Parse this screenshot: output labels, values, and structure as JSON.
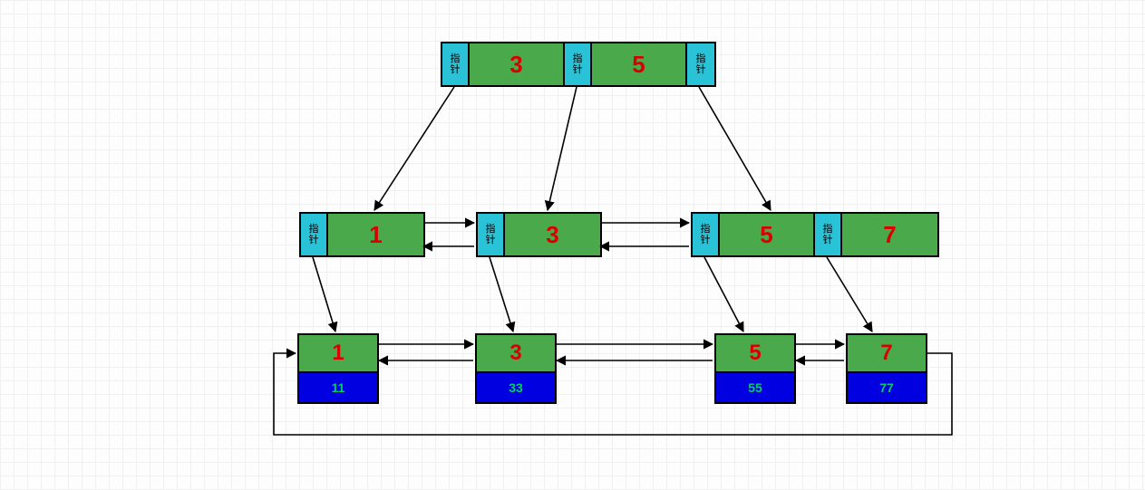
{
  "pointer_label": "指\n针",
  "root": {
    "keys": [
      "3",
      "5"
    ]
  },
  "mid": [
    {
      "keys": [
        "1"
      ]
    },
    {
      "keys": [
        "3"
      ]
    },
    {
      "keys": [
        "5",
        "7"
      ]
    }
  ],
  "leaves": [
    {
      "key": "1",
      "value": "11"
    },
    {
      "key": "3",
      "value": "33"
    },
    {
      "key": "5",
      "value": "55"
    },
    {
      "key": "7",
      "value": "77"
    }
  ],
  "colors": {
    "pointer_bg": "#29c2d6",
    "key_bg": "#4aa94a",
    "key_fg": "#d90000",
    "value_bg": "#0000e0",
    "value_fg": "#00d060"
  }
}
